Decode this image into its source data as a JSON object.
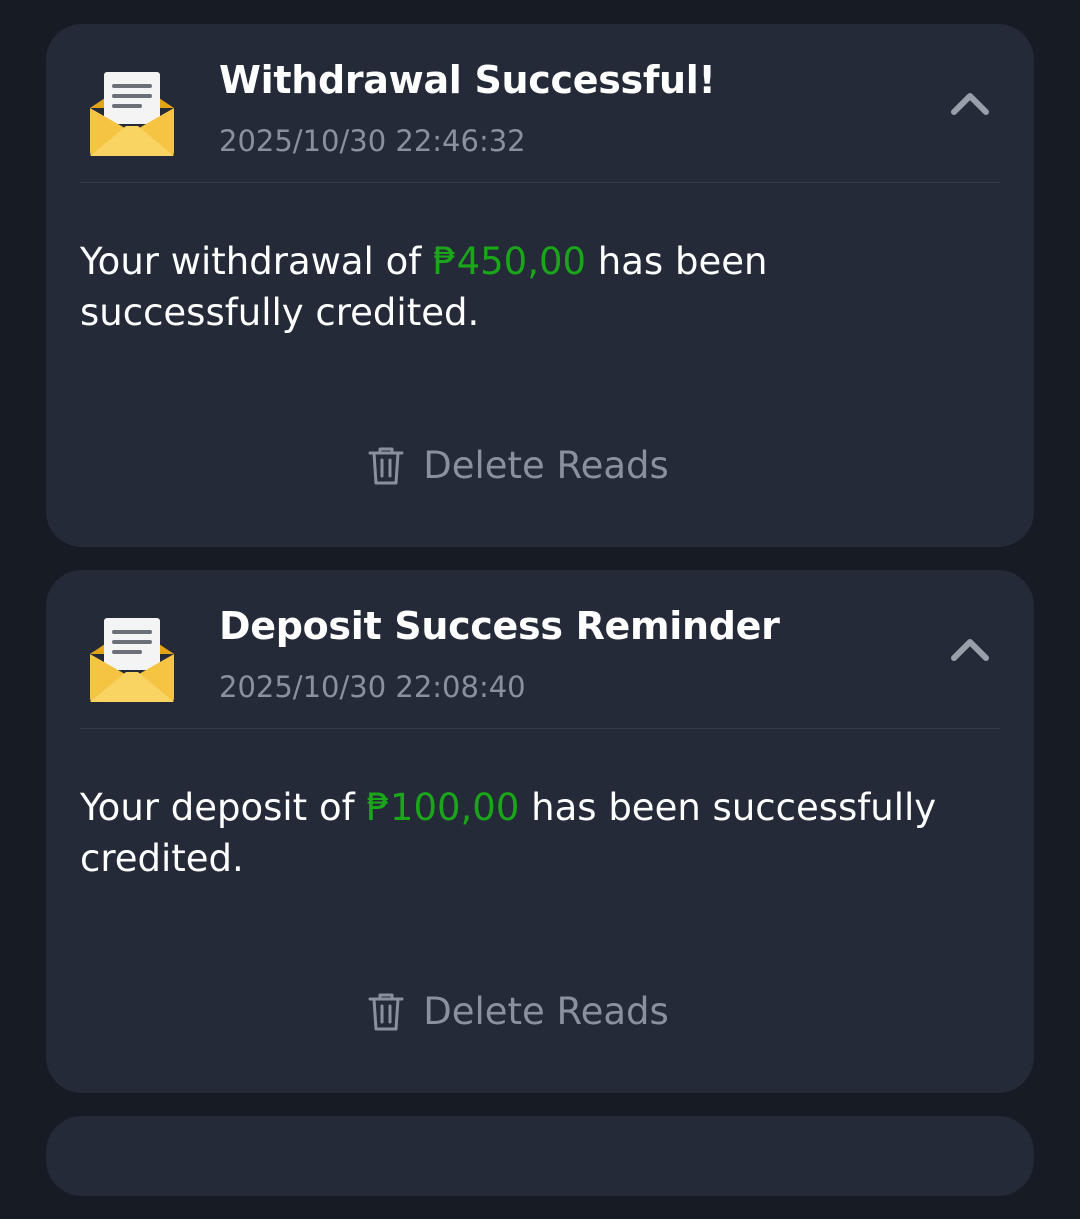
{
  "notifications": [
    {
      "title": "Withdrawal Successful!",
      "time": "2025/10/30 22:46:32",
      "msg_before": "Your withdrawal of ",
      "amount": "₱450,00",
      "msg_after": " has been successfully credited.",
      "delete_label": "Delete Reads"
    },
    {
      "title": "Deposit Success Reminder",
      "time": "2025/10/30 22:08:40",
      "msg_before": "Your deposit of ",
      "amount": "₱100,00",
      "msg_after": " has been successfully credited.",
      "delete_label": "Delete Reads"
    }
  ],
  "icons": {
    "envelope": "open-envelope-icon",
    "collapse": "chevron-up-icon",
    "delete": "trash-icon"
  },
  "colors": {
    "background": "#171b24",
    "card": "#242a38",
    "amount": "#1aa51a",
    "muted": "#8a909c"
  }
}
